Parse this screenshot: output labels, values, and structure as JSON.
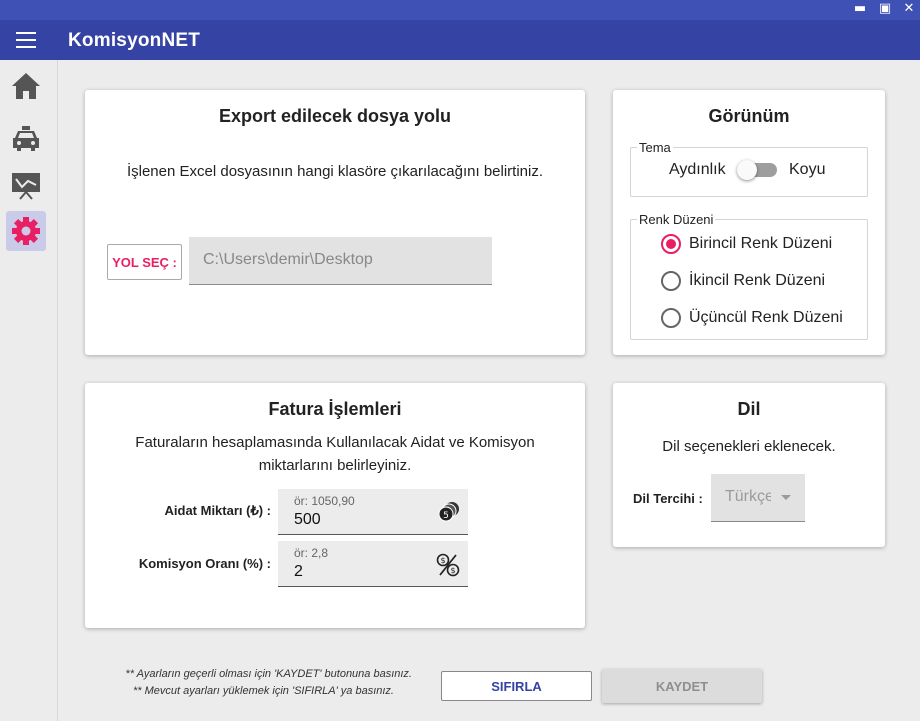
{
  "app": {
    "title": "KomisyonNET"
  },
  "window_controls": {
    "minimize": "▬",
    "maximize": "▣",
    "close": "✕"
  },
  "sidebar": {
    "items": [
      {
        "name": "home-icon",
        "active": false
      },
      {
        "name": "taxi-icon",
        "active": false
      },
      {
        "name": "chart-board-icon",
        "active": false
      },
      {
        "name": "gear-icon",
        "active": true
      }
    ],
    "accent": "#e91e63"
  },
  "export": {
    "title": "Export edilecek dosya yolu",
    "description": "İşlenen Excel dosyasının hangi klasöre çıkarılacağını belirtiniz.",
    "choose_button": "YOL SEÇ :",
    "path": "C:\\Users\\demir\\Desktop"
  },
  "appearance": {
    "title": "Görünüm",
    "theme": {
      "legend": "Tema",
      "light": "Aydınlık",
      "dark": "Koyu",
      "is_dark": false
    },
    "color_scheme": {
      "legend": "Renk Düzeni",
      "options": [
        "Birincil Renk Düzeni",
        "İkincil Renk Düzeni",
        "Üçüncül Renk Düzeni"
      ],
      "selected": "Birincil Renk Düzeni"
    }
  },
  "invoice": {
    "title": "Fatura İşlemleri",
    "description_line1": "Faturaların hesaplamasında Kullanılacak Aidat ve Komisyon",
    "description_line2": "miktarlarını belirleyiniz.",
    "fee": {
      "label": "Aidat Miktarı (₺) :",
      "hint": "ör: 1050,90",
      "value": "500",
      "icon": "coins-icon"
    },
    "commission": {
      "label": "Komisyon Oranı (%) :",
      "hint": "ör: 2,8",
      "value": "2",
      "icon": "percent-money-icon"
    }
  },
  "language": {
    "title": "Dil",
    "description": "Dil seçenekleri eklenecek.",
    "label": "Dil Tercihi :",
    "selected": "Türkçe"
  },
  "footer": {
    "note1": "** Ayarların geçerli olması için 'KAYDET' butonuna basınız.",
    "note2": "** Mevcut ayarları yüklemek için 'SIFIRLA' ya basınız.",
    "reset_button": "SIFIRLA",
    "save_button": "KAYDET"
  },
  "colors": {
    "primary": "#3443a4",
    "titlebar": "#3f51b5",
    "accent": "#e91e63"
  }
}
